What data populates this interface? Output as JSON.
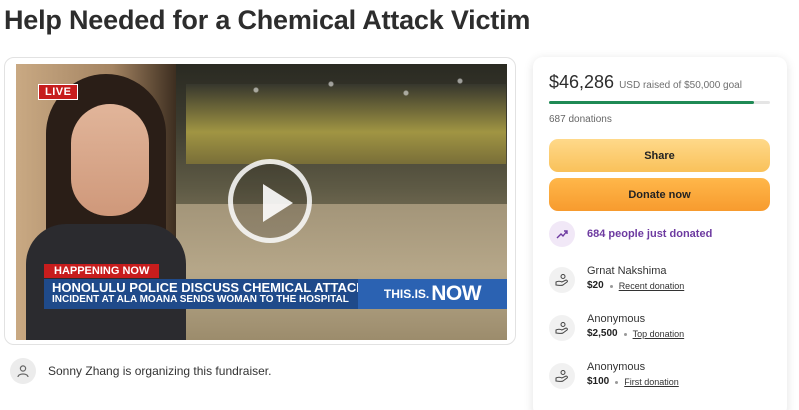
{
  "page": {
    "title": "Help Needed for a Chemical Attack Victim"
  },
  "video": {
    "live_badge": "LIVE",
    "happening_now": "HAPPENING NOW",
    "headline": "HONOLULU POLICE DISCUSS CHEMICAL ATTACK",
    "subheadline": "INCIDENT AT ALA MOANA SENDS WOMAN TO THE HOSPITAL",
    "brand_prefix": "THIS.IS.",
    "brand_main": "NOW"
  },
  "organizer": {
    "text": "Sonny Zhang is organizing this fundraiser."
  },
  "donation_card": {
    "raised": "$46,286",
    "goal_text": "USD raised of $50,000 goal",
    "progress_fraction": 0.926,
    "donation_count": "687 donations",
    "share_label": "Share",
    "donate_label": "Donate now",
    "trending_text": "684 people just donated",
    "colors": {
      "progress": "#1f8a55",
      "share": "#f9c15a",
      "donate": "#f79b2e",
      "trending": "#6d3aa0"
    },
    "donors": [
      {
        "name": "Grnat Nakshima",
        "amount": "$20",
        "tag": "Recent donation"
      },
      {
        "name": "Anonymous",
        "amount": "$2,500",
        "tag": "Top donation"
      },
      {
        "name": "Anonymous",
        "amount": "$100",
        "tag": "First donation"
      }
    ]
  }
}
